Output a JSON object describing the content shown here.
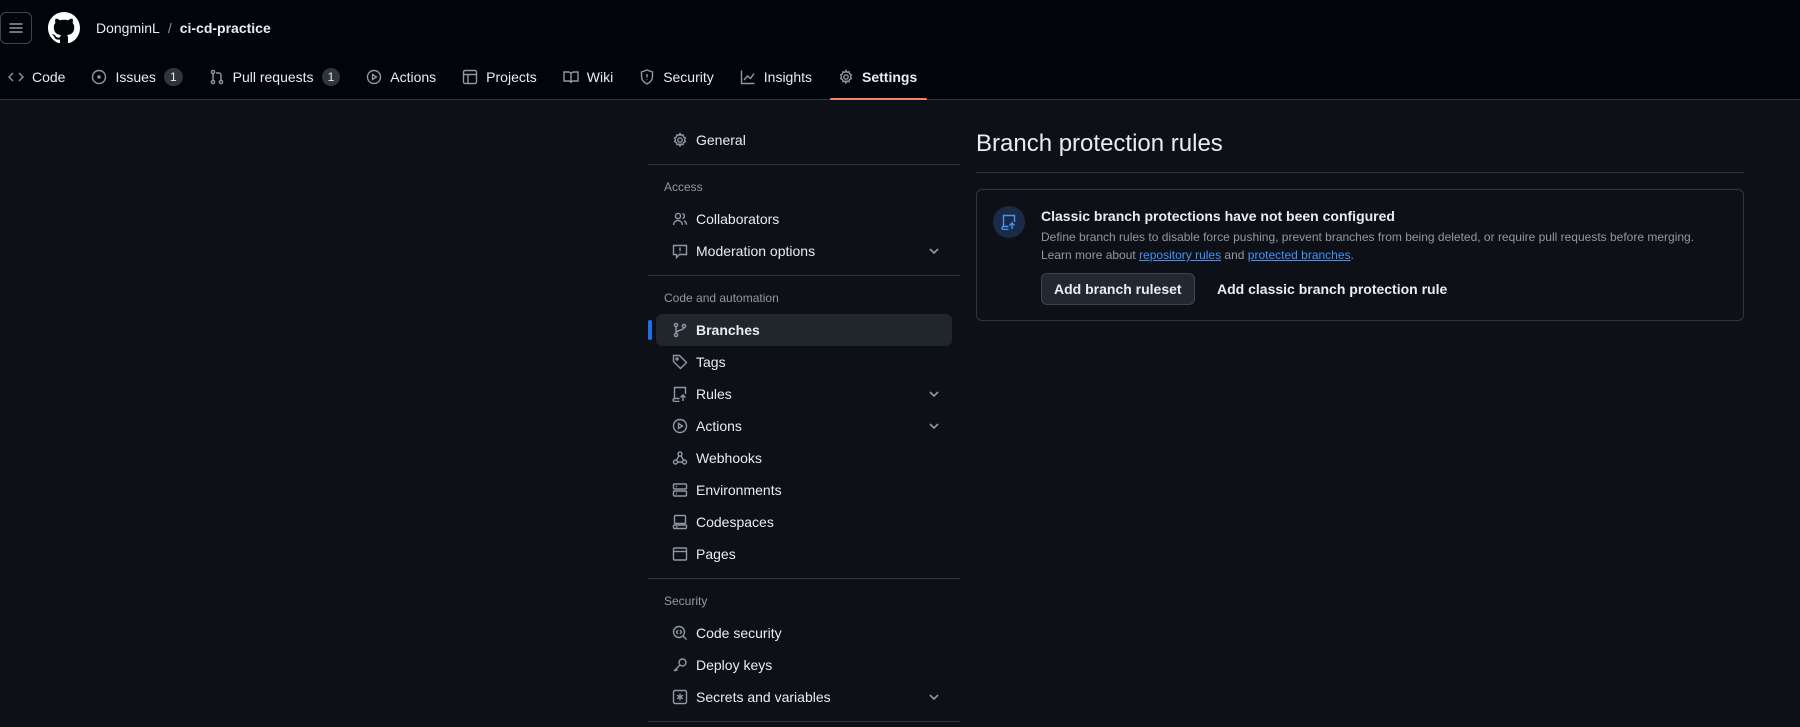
{
  "header": {
    "owner": "DongminL",
    "separator": "/",
    "repo": "ci-cd-practice"
  },
  "tabs": [
    {
      "label": "Code",
      "icon": "code-icon"
    },
    {
      "label": "Issues",
      "icon": "issue-icon",
      "count": "1"
    },
    {
      "label": "Pull requests",
      "icon": "pull-request-icon",
      "count": "1"
    },
    {
      "label": "Actions",
      "icon": "play-icon"
    },
    {
      "label": "Projects",
      "icon": "table-icon"
    },
    {
      "label": "Wiki",
      "icon": "book-icon"
    },
    {
      "label": "Security",
      "icon": "shield-icon"
    },
    {
      "label": "Insights",
      "icon": "graph-icon"
    },
    {
      "label": "Settings",
      "icon": "gear-icon"
    }
  ],
  "sidebar": {
    "general": "General",
    "access_heading": "Access",
    "collaborators": "Collaborators",
    "moderation": "Moderation options",
    "code_heading": "Code and automation",
    "branches": "Branches",
    "tags": "Tags",
    "rules": "Rules",
    "actions": "Actions",
    "webhooks": "Webhooks",
    "environments": "Environments",
    "codespaces": "Codespaces",
    "pages": "Pages",
    "security_heading": "Security",
    "code_security": "Code security",
    "deploy_keys": "Deploy keys",
    "secrets": "Secrets and variables"
  },
  "main": {
    "title": "Branch protection rules",
    "blank_title": "Classic branch protections have not been configured",
    "desc_line1": "Define branch rules to disable force pushing, prevent branches from being deleted, or require pull requests before merging.",
    "desc_prefix": "Learn more about ",
    "link_repo_rules": "repository rules",
    "desc_and": " and ",
    "link_protected": "protected branches",
    "desc_suffix": ".",
    "add_ruleset_button": "Add branch ruleset",
    "add_classic_button": "Add classic branch protection rule"
  },
  "colors": {
    "background": "#0d1117",
    "header_background": "#010409",
    "active_tab_underline": "#f78166",
    "accent": "#1f6feb",
    "link": "#4493f8"
  }
}
